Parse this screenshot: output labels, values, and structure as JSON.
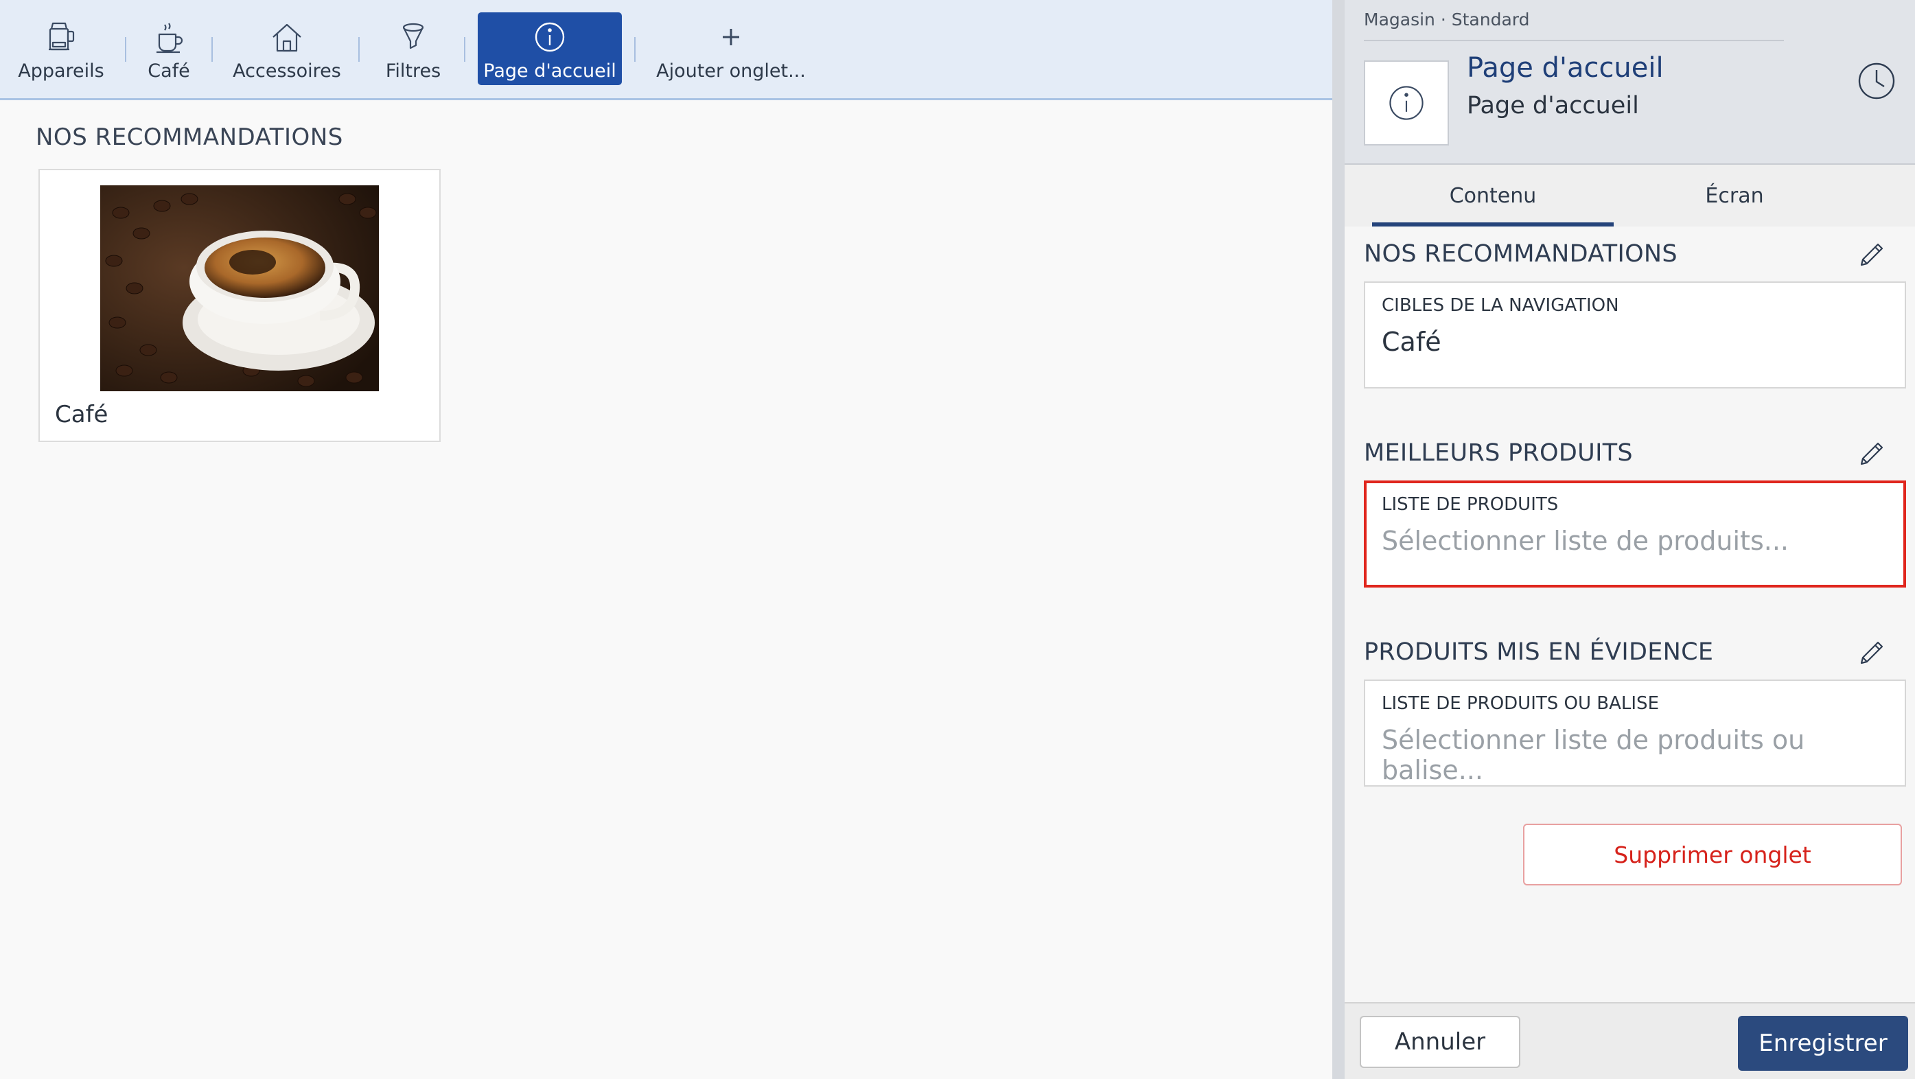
{
  "tabs": [
    {
      "label": "Appareils",
      "icon": "appliance-icon"
    },
    {
      "label": "Café",
      "icon": "coffee-cup-icon"
    },
    {
      "label": "Accessoires",
      "icon": "house-icon"
    },
    {
      "label": "Filtres",
      "icon": "filter-icon"
    },
    {
      "label": "Page d'accueil",
      "icon": "info-icon",
      "active": true
    },
    {
      "label": "Ajouter onglet...",
      "icon": "plus-icon"
    }
  ],
  "main": {
    "section_title": "NOS RECOMMANDATIONS",
    "card": {
      "label": "Café",
      "image": "coffee-cup-photo"
    }
  },
  "panel": {
    "breadcrumb": "Magasin · Standard",
    "title": "Page d'accueil",
    "subtitle": "Page d'accueil",
    "tabs": [
      {
        "label": "Contenu",
        "active": true
      },
      {
        "label": "Écran",
        "active": false
      }
    ],
    "sections": [
      {
        "title": "NOS RECOMMANDATIONS",
        "field_label": "CIBLES DE LA NAVIGATION",
        "value": "Café",
        "placeholder": ""
      },
      {
        "title": "MEILLEURS PRODUITS",
        "field_label": "LISTE DE PRODUITS",
        "value": "",
        "placeholder": "Sélectionner liste de produits..."
      },
      {
        "title": "PRODUITS MIS EN ÉVIDENCE",
        "field_label": "LISTE DE PRODUITS OU BALISE",
        "value": "",
        "placeholder": "Sélectionner liste de produits ou balise..."
      }
    ],
    "delete_button": "Supprimer onglet",
    "cancel_button": "Annuler",
    "save_button": "Enregistrer"
  },
  "colors": {
    "accent": "#1f4fa6",
    "highlight_border": "#e0261d",
    "danger_text": "#d6221b",
    "save_bg": "#2b4a7e"
  }
}
